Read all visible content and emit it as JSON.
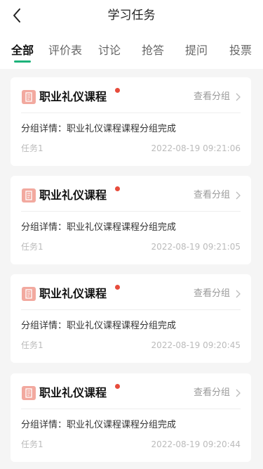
{
  "header": {
    "title": "学习任务",
    "back_icon": "chevron-left-icon"
  },
  "tabs": [
    {
      "label": "全部",
      "active": true
    },
    {
      "label": "评价表",
      "active": false
    },
    {
      "label": "讨论",
      "active": false
    },
    {
      "label": "抢答",
      "active": false
    },
    {
      "label": "提问",
      "active": false
    },
    {
      "label": "投票",
      "active": false
    }
  ],
  "colors": {
    "accent": "#1db37a",
    "badge": "#e74c3c",
    "course_icon": "#f2a99f"
  },
  "cards": [
    {
      "title": "职业礼仪课程",
      "action": "查看分组",
      "detail": "分组详情：职业礼仪课程课程分组完成",
      "task": "任务1",
      "time": "2022-08-19 09:21:06"
    },
    {
      "title": "职业礼仪课程",
      "action": "查看分组",
      "detail": "分组详情：职业礼仪课程课程分组完成",
      "task": "任务1",
      "time": "2022-08-19 09:21:05"
    },
    {
      "title": "职业礼仪课程",
      "action": "查看分组",
      "detail": "分组详情：职业礼仪课程课程分组完成",
      "task": "任务1",
      "time": "2022-08-19 09:20:45"
    },
    {
      "title": "职业礼仪课程",
      "action": "查看分组",
      "detail": "分组详情：职业礼仪课程课程分组完成",
      "task": "任务1",
      "time": "2022-08-19 09:20:44"
    }
  ]
}
